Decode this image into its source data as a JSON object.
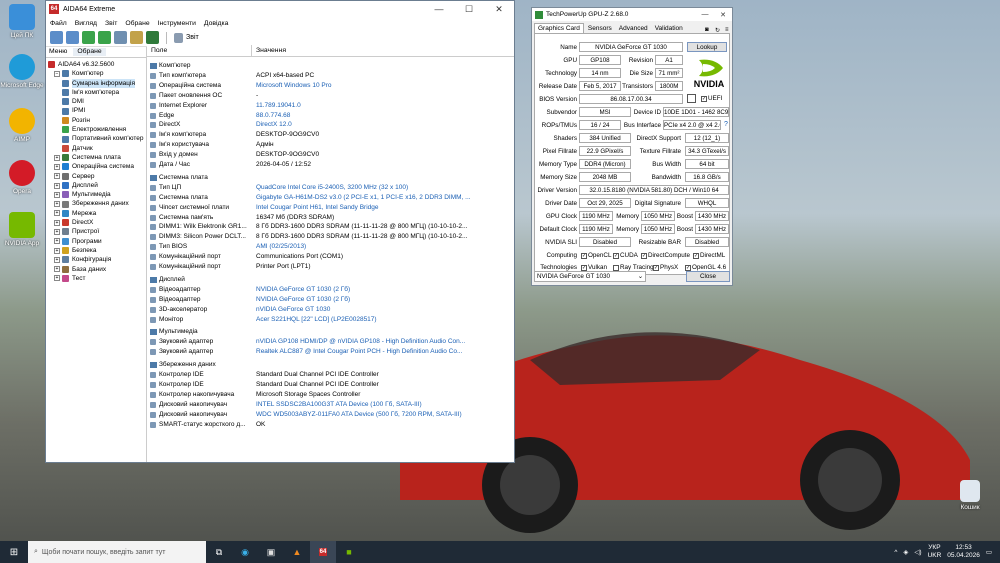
{
  "desktop": {
    "icons": [
      {
        "label": "Цей ПК",
        "color": "#3a8fd9"
      },
      {
        "label": "Microsoft Edge",
        "color": "#1f9bd8"
      },
      {
        "label": "AIMP",
        "color": "#f2b400"
      },
      {
        "label": "Opera",
        "color": "#d31b27"
      },
      {
        "label": "NVIDIA App",
        "color": "#76b900"
      }
    ],
    "recycle_bin": "Кошик"
  },
  "aida": {
    "title": "AIDA64 Extreme",
    "menu": [
      "Файл",
      "Вигляд",
      "Звіт",
      "Обране",
      "Інструменти",
      "Довідка"
    ],
    "toolbar_report": "Звіт",
    "left_tabs": [
      "Меню",
      "Обране"
    ],
    "tree": [
      {
        "label": "AIDA64 v6.32.5600",
        "level": 0,
        "color": "#c52b2b"
      },
      {
        "label": "Комп'ютер",
        "level": 1,
        "color": "#4d7aa8",
        "open": true
      },
      {
        "label": "Сумарна інформація",
        "level": 2,
        "color": "#4d7aa8",
        "sel": true
      },
      {
        "label": "Ім'я комп'ютера",
        "level": 2,
        "color": "#4d7aa8"
      },
      {
        "label": "DMI",
        "level": 2,
        "color": "#4d7aa8"
      },
      {
        "label": "IPMI",
        "level": 2,
        "color": "#4d7aa8"
      },
      {
        "label": "Розгін",
        "level": 2,
        "color": "#d08a1f"
      },
      {
        "label": "Електроживлення",
        "level": 2,
        "color": "#3aa34a"
      },
      {
        "label": "Портативний комп'ютер",
        "level": 2,
        "color": "#4d7aa8"
      },
      {
        "label": "Датчик",
        "level": 2,
        "color": "#c94a3a"
      },
      {
        "label": "Системна плата",
        "level": 1,
        "color": "#3a7a3a"
      },
      {
        "label": "Операційна система",
        "level": 1,
        "color": "#1f7fd1"
      },
      {
        "label": "Сервер",
        "level": 1,
        "color": "#6f6f6f"
      },
      {
        "label": "Дисплей",
        "level": 1,
        "color": "#2f72c4"
      },
      {
        "label": "Мультимедіа",
        "level": 1,
        "color": "#8a5fb8"
      },
      {
        "label": "Збереження даних",
        "level": 1,
        "color": "#7a7a7a"
      },
      {
        "label": "Мережа",
        "level": 1,
        "color": "#2f86c4"
      },
      {
        "label": "DirectX",
        "level": 1,
        "color": "#c9392c"
      },
      {
        "label": "Пристрої",
        "level": 1,
        "color": "#6f7f8f"
      },
      {
        "label": "Програми",
        "level": 1,
        "color": "#3f8fcf"
      },
      {
        "label": "Безпека",
        "level": 1,
        "color": "#d0a21f"
      },
      {
        "label": "Конфігурація",
        "level": 1,
        "color": "#5f7fa0"
      },
      {
        "label": "База даних",
        "level": 1,
        "color": "#8f6f3f"
      },
      {
        "label": "Тест",
        "level": 1,
        "color": "#c44a8a"
      }
    ],
    "col_field": "Поле",
    "col_value": "Значення",
    "sections": [
      {
        "title": "Комп'ютер",
        "rows": [
          {
            "f": "Тип комп'ютера",
            "v": "ACPI x64-based PC"
          },
          {
            "f": "Операційна система",
            "v": "Microsoft Windows 10 Pro",
            "link": true
          },
          {
            "f": "Пакет оновлення ОС",
            "v": "-"
          },
          {
            "f": "Internet Explorer",
            "v": "11.789.19041.0",
            "link": true
          },
          {
            "f": "Edge",
            "v": "88.0.774.68",
            "link": true
          },
          {
            "f": "DirectX",
            "v": "DirectX 12.0",
            "link": true
          },
          {
            "f": "Ім'я комп'ютера",
            "v": "DESKTOP-9OG9CV0"
          },
          {
            "f": "Ім'я користувача",
            "v": "Адмін"
          },
          {
            "f": "Вхід у домен",
            "v": "DESKTOP-9OG9CV0"
          },
          {
            "f": "Дата / Час",
            "v": "2026-04-05 / 12:52"
          }
        ]
      },
      {
        "title": "Системна плата",
        "rows": [
          {
            "f": "Тип ЦП",
            "v": "QuadCore Intel Core i5-2400S, 3200 MHz (32 x 100)",
            "link": true
          },
          {
            "f": "Системна плата",
            "v": "Gigabyte GA-H61M-DS2 v3.0  (2 PCI-E x1, 1 PCI-E x16, 2 DDR3 DIMM, ...",
            "link": true
          },
          {
            "f": "Чіпсет системної плати",
            "v": "Intel Cougar Point H61, Intel Sandy Bridge",
            "link": true
          },
          {
            "f": "Системна пам'ять",
            "v": "16347 Мб  (DDR3 SDRAM)"
          },
          {
            "f": "DIMM1: Wilk Elektronik GR1...",
            "v": "8 Гб DDR3-1600 DDR3 SDRAM  (11-11-11-28 @ 800 МГЦ)  (10-10-10-2..."
          },
          {
            "f": "DIMM3: Silicon Power DCLT...",
            "v": "8 Гб DDR3-1600 DDR3 SDRAM  (11-11-11-28 @ 800 МГЦ)  (10-10-10-2..."
          },
          {
            "f": "Тип BIOS",
            "v": "AMI (02/25/2013)",
            "link": true
          },
          {
            "f": "Комунікаційний порт",
            "v": "Communications Port (COM1)"
          },
          {
            "f": "Комунікаційний порт",
            "v": "Printer Port (LPT1)"
          }
        ]
      },
      {
        "title": "Дисплей",
        "rows": [
          {
            "f": "Відеоадаптер",
            "v": "NVIDIA GeForce GT 1030  (2 Гб)",
            "link": true
          },
          {
            "f": "Відеоадаптер",
            "v": "NVIDIA GeForce GT 1030  (2 Гб)",
            "link": true
          },
          {
            "f": "3D-акселератор",
            "v": "nVIDIA GeForce GT 1030",
            "link": true
          },
          {
            "f": "Монітор",
            "v": "Acer S221HQL  [22\" LCD]  (LP2E0028517)",
            "link": true
          }
        ]
      },
      {
        "title": "Мультимедіа",
        "rows": [
          {
            "f": "Звуковий адаптер",
            "v": "nVIDIA GP108 HDMI/DP @ nVIDIA GP108 - High Definition Audio Con...",
            "link": true
          },
          {
            "f": "Звуковий адаптер",
            "v": "Realtek ALC887 @ Intel Cougar Point PCH - High Definition Audio Co...",
            "link": true
          }
        ]
      },
      {
        "title": "Збереження даних",
        "rows": [
          {
            "f": "Контролер IDE",
            "v": "Standard Dual Channel PCI IDE Controller"
          },
          {
            "f": "Контролер IDE",
            "v": "Standard Dual Channel PCI IDE Controller"
          },
          {
            "f": "Контролер накопичувача",
            "v": "Microsoft Storage Spaces Controller"
          },
          {
            "f": "Дисковий накопичувач",
            "v": "INTEL SSDSC2BA100G3T ATA Device  (100 Гб, SATA-III)",
            "link": true
          },
          {
            "f": "Дисковий накопичувач",
            "v": "WDC WD5003ABYZ-011FA0 ATA Device  (500 Гб, 7200 RPM, SATA-III)",
            "link": true
          },
          {
            "f": "SMART-статус жорсткого д...",
            "v": "OK"
          }
        ]
      }
    ]
  },
  "gpuz": {
    "title": "TechPowerUp GPU-Z 2.68.0",
    "tabs": [
      "Graphics Card",
      "Sensors",
      "Advanced",
      "Validation"
    ],
    "labels": {
      "name": "Name",
      "gpu": "GPU",
      "revision": "Revision",
      "technology": "Technology",
      "die_size": "Die Size",
      "release_date": "Release Date",
      "transistors": "Transistors",
      "bios_version": "BIOS Version",
      "subvendor": "Subvendor",
      "device_id": "Device ID",
      "rops": "ROPs/TMUs",
      "bus_interface": "Bus Interface",
      "shaders": "Shaders",
      "directx": "DirectX Support",
      "pixel_fillrate": "Pixel Fillrate",
      "texture_fillrate": "Texture Fillrate",
      "memory_type": "Memory Type",
      "bus_width": "Bus Width",
      "memory_size": "Memory Size",
      "bandwidth": "Bandwidth",
      "driver_version": "Driver Version",
      "driver_date": "Driver Date",
      "digital_signature": "Digital Signature",
      "gpu_clock": "GPU Clock",
      "memory": "Memory",
      "boost": "Boost",
      "default_clock": "Default Clock",
      "sli": "NVIDIA SLI",
      "resizable_bar": "Resizable BAR",
      "computing": "Computing",
      "technologies": "Technologies"
    },
    "values": {
      "name": "NVIDIA GeForce GT 1030",
      "gpu": "GP108",
      "revision": "A1",
      "technology": "14 nm",
      "die_size": "71 mm²",
      "release_date": "Feb 5, 2017",
      "transistors": "1800M",
      "bios_version": "86.08.17.00.34",
      "subvendor": "MSI",
      "device_id": "10DE 1D01 - 1462 8C98",
      "rops": "16 / 24",
      "bus_interface": "PCIe x4 2.0 @ x4 2.0",
      "shaders": "384 Unified",
      "directx": "12 (12_1)",
      "pixel_fillrate": "22.9 GPixel/s",
      "texture_fillrate": "34.3 GTexel/s",
      "memory_type": "DDR4 (Micron)",
      "bus_width": "64 bit",
      "memory_size": "2048 MB",
      "bandwidth": "16.8 GB/s",
      "driver_version": "32.0.15.8180 (NVIDIA 581.80) DCH / Win10 64",
      "driver_date": "Oct 29, 2025",
      "digital_signature": "WHQL",
      "gpu_clock": "1190 MHz",
      "memory_clock": "1050 MHz",
      "boost_clock": "1430 MHz",
      "def_gpu_clock": "1190 MHz",
      "def_memory_clock": "1050 MHz",
      "def_boost_clock": "1430 MHz",
      "sli": "Disabled",
      "resizable_bar": "Disabled"
    },
    "computing": [
      "OpenCL",
      "CUDA",
      "DirectCompute",
      "DirectML"
    ],
    "technologies": [
      "Vulkan",
      "Ray Tracing",
      "PhysX",
      "OpenGL 4.6"
    ],
    "technologies_checked": [
      true,
      false,
      true,
      true
    ],
    "uefi": "UEFI",
    "lookup": "Lookup",
    "close": "Close",
    "selected_card": "NVIDIA GeForce GT 1030",
    "logo": "NVIDIA"
  },
  "taskbar": {
    "search_placeholder": "Щоби почати пошук, введіть запит тут",
    "lang": "УКР",
    "lang2": "UKR",
    "time": "12:53",
    "date": "05.04.2026"
  }
}
